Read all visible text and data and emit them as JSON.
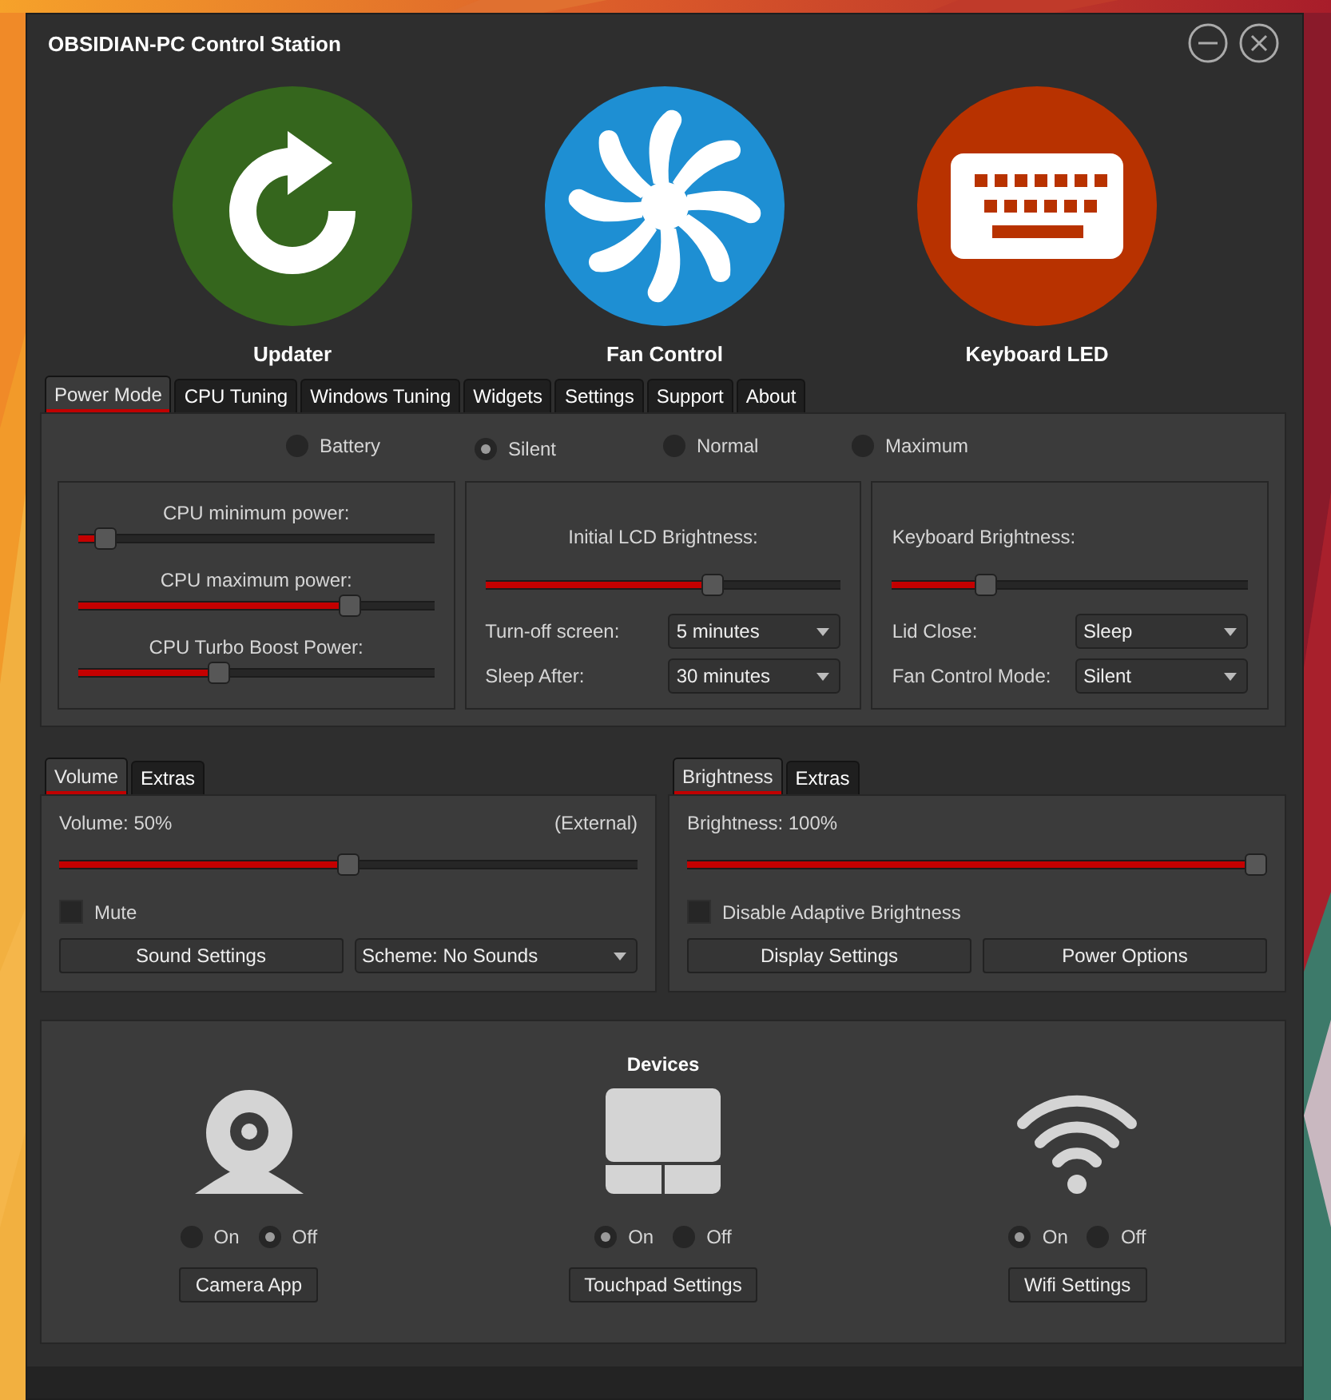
{
  "window": {
    "title": "OBSIDIAN-PC Control Station"
  },
  "launchers": [
    {
      "kind": "updater",
      "label": "Updater"
    },
    {
      "kind": "fan",
      "label": "Fan Control"
    },
    {
      "kind": "keyboard",
      "label": "Keyboard LED"
    }
  ],
  "tabs": [
    {
      "label": "Power Mode",
      "selected": true
    },
    {
      "label": "CPU Tuning",
      "selected": false
    },
    {
      "label": "Windows Tuning",
      "selected": false
    },
    {
      "label": "Widgets",
      "selected": false
    },
    {
      "label": "Settings",
      "selected": false
    },
    {
      "label": "Support",
      "selected": false
    },
    {
      "label": "About",
      "selected": false
    }
  ],
  "power_modes": [
    {
      "label": "Battery",
      "selected": false
    },
    {
      "label": "Silent",
      "selected": true
    },
    {
      "label": "Normal",
      "selected": false
    },
    {
      "label": "Maximum",
      "selected": false
    }
  ],
  "cpu_sliders": [
    {
      "label": "CPU minimum power:",
      "level": 0.05
    },
    {
      "label": "CPU maximum power:",
      "level": 0.78
    },
    {
      "label": "CPU Turbo Boost Power:",
      "level": 0.39
    }
  ],
  "lcd": {
    "label": "Initial LCD Brightness:",
    "level": 0.65,
    "fields": [
      {
        "label": "Turn-off screen:",
        "value": "5 minutes"
      },
      {
        "label": "Sleep After:",
        "value": "30 minutes"
      }
    ]
  },
  "keyboard": {
    "label": "Keyboard Brightness:",
    "level": 0.25,
    "fields": [
      {
        "label": "Lid Close:",
        "value": "Sleep"
      },
      {
        "label": "Fan Control Mode:",
        "value": "Silent"
      }
    ]
  },
  "volume_panel": {
    "tabs": [
      {
        "label": "Volume",
        "selected": true
      },
      {
        "label": "Extras",
        "selected": false
      }
    ],
    "label": "Volume: 50%",
    "note": "(External)",
    "level": 0.5,
    "checkbox": {
      "label": "Mute",
      "checked": false
    },
    "buttons": [
      {
        "kind": "button",
        "label": "Sound Settings"
      },
      {
        "kind": "dropdown",
        "label": "Scheme: No Sounds"
      }
    ]
  },
  "brightness_panel": {
    "tabs": [
      {
        "label": "Brightness",
        "selected": true
      },
      {
        "label": "Extras",
        "selected": false
      }
    ],
    "label": "Brightness: 100%",
    "level": 1,
    "checkbox": {
      "label": "Disable Adaptive Brightness",
      "checked": false
    },
    "buttons": [
      {
        "kind": "button",
        "label": "Display Settings"
      },
      {
        "kind": "button",
        "label": "Power Options"
      }
    ]
  },
  "devices": {
    "title": "Devices",
    "items": [
      {
        "kind": "camera",
        "options": [
          {
            "label": "On",
            "selected": false
          },
          {
            "label": "Off",
            "selected": true
          }
        ],
        "button": "Camera App"
      },
      {
        "kind": "touchpad",
        "options": [
          {
            "label": "On",
            "selected": true
          },
          {
            "label": "Off",
            "selected": false
          }
        ],
        "button": "Touchpad Settings"
      },
      {
        "kind": "wifi",
        "options": [
          {
            "label": "On",
            "selected": true
          },
          {
            "label": "Off",
            "selected": false
          }
        ],
        "button": "Wifi Settings"
      }
    ]
  }
}
